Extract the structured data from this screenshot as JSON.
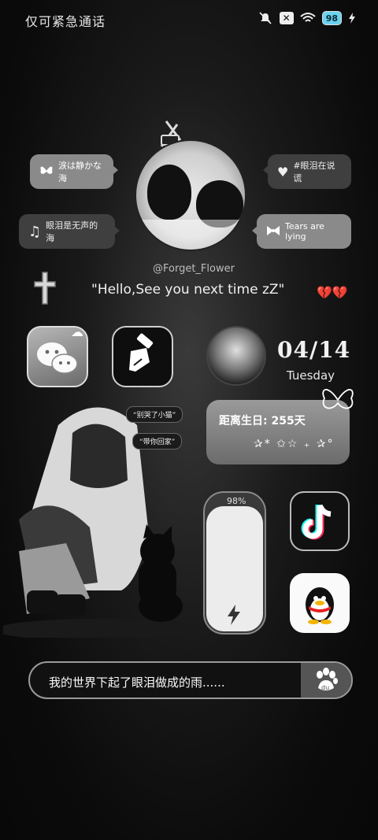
{
  "status_bar": {
    "carrier_text": "仅可紧急通话",
    "battery": "98",
    "icons": [
      "mute-icon",
      "x-badge-icon",
      "wifi-icon",
      "battery-icon",
      "charging-icon"
    ]
  },
  "bubbles": [
    {
      "text": "涙は静かな海",
      "icon": "butterfly-icon"
    },
    {
      "text": "眼泪是无声的海",
      "icon": "music-note-icon"
    },
    {
      "text": "#眼泪在说谎",
      "icon": "heart-icon"
    },
    {
      "text": "Tears are lying",
      "icon": "bow-icon"
    }
  ],
  "profile": {
    "handle": "@Forget_Flower",
    "quote": "\"Hello,See you next time zZ\""
  },
  "widgets": {
    "date": "04/14",
    "weekday": "Tuesday",
    "birthday_text": "距离生日: 255天",
    "battery_percent": "98%",
    "battery_level": 0.98,
    "search_text": "我的世界下起了眼泪做成的雨......",
    "sticker_tags": [
      "“别哭了小猫”",
      "“带你回家”"
    ]
  },
  "apps": [
    {
      "name": "WeChat",
      "icon": "wechat-icon"
    },
    {
      "name": "Theme",
      "icon": "paint-brush-icon"
    },
    {
      "name": "TikTok",
      "icon": "tiktok-icon"
    },
    {
      "name": "QQ",
      "icon": "qq-penguin-icon"
    },
    {
      "name": "Baidu",
      "icon": "baidu-paw-icon"
    }
  ]
}
